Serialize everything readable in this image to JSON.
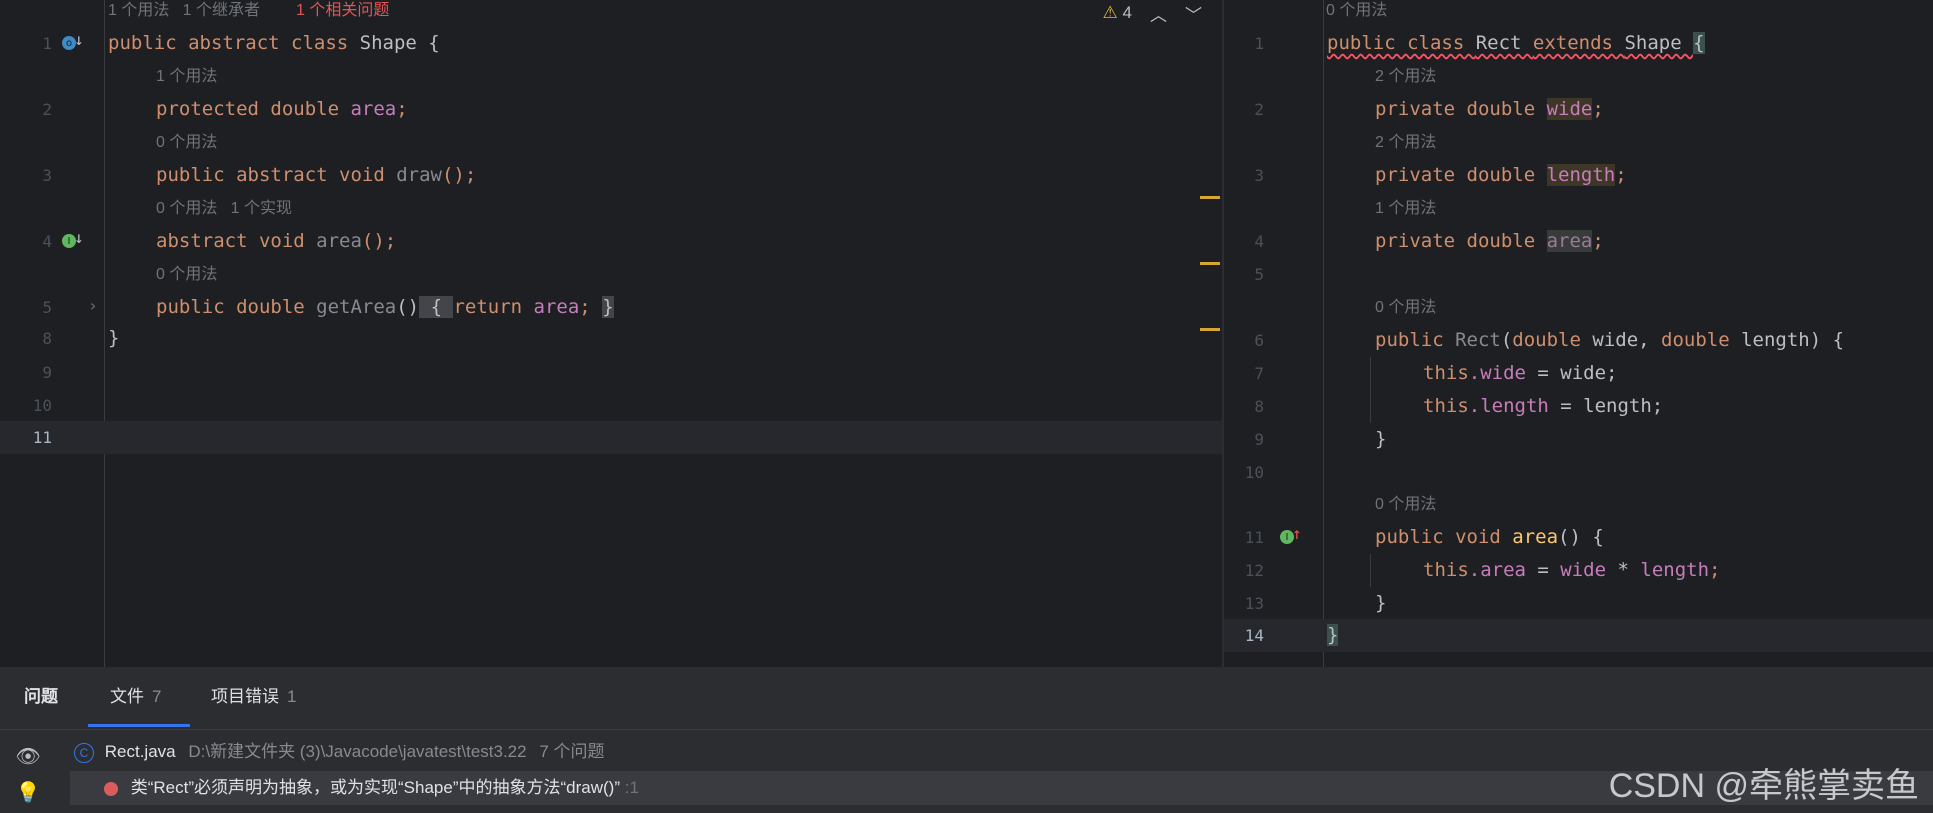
{
  "left": {
    "hint_top": "1 个用法   1 个继承者",
    "hint_problem": "1 个相关问题",
    "warning_count": "4",
    "line_numbers": [
      "1",
      "2",
      "3",
      "4",
      "5",
      "8",
      "9",
      "10",
      "11"
    ],
    "hints": [
      "1 个用法",
      "0 个用法",
      "0 个用法   1 个实现",
      "0 个用法"
    ],
    "code": {
      "l1_kw": "public abstract class ",
      "l1_name": "Shape {",
      "l2_kw": "protected double ",
      "l2_fld": "area",
      "l2_end": ";",
      "l3_kw": "public abstract void ",
      "l3_fn": "draw",
      "l3_end": "();",
      "l4_kw": "abstract void ",
      "l4_fn": "area",
      "l4_end": "();",
      "l5_kw": "public double ",
      "l5_fn": "getArea",
      "l5_paren": "()",
      "l5_open": " { ",
      "l5_ret": "return ",
      "l5_fld": "area",
      "l5_semi": "; ",
      "l5_close": "}",
      "l8": "}"
    }
  },
  "right": {
    "hint_top": "0 个用法",
    "line_numbers": [
      "1",
      "2",
      "3",
      "4",
      "5",
      "6",
      "7",
      "8",
      "9",
      "10",
      "11",
      "12",
      "13",
      "14"
    ],
    "hints": [
      "2 个用法",
      "2 个用法",
      "1 个用法",
      "0 个用法",
      "0 个用法"
    ],
    "code": {
      "l1_kw": "public class ",
      "l1_name": "Rect ",
      "l1_ext": "extends ",
      "l1_sup": "Shape ",
      "l1_brace": "{",
      "l2_kw": "private double ",
      "l2_fld": "wide",
      "l3_kw": "private double ",
      "l3_fld": "length",
      "l4_kw": "private double ",
      "l4_fld": "area",
      "semi": ";",
      "l6_kw": "public ",
      "l6_fn": "Rect",
      "l6_p1": "(",
      "l6_t1": "double ",
      "l6_a1": "wide, ",
      "l6_t2": "double ",
      "l6_a2": "length) {",
      "l7_this": "this",
      "l7_fld": ".wide",
      "l7_rest": " = wide;",
      "l8_this": "this",
      "l8_fld": ".length",
      "l8_rest": " = length;",
      "l9": "}",
      "l11_kw": "public void ",
      "l11_fn": "area",
      "l11_rest": "() {",
      "l12_this": "this",
      "l12_fld": ".area",
      "l12_eq": " = ",
      "l12_a": "wide",
      "l12_op": " * ",
      "l12_b": "length",
      "l12_end": ";",
      "l13": "}",
      "l14": "}"
    }
  },
  "problems": {
    "tab1": "问题",
    "tab2": "文件",
    "tab2_count": "7",
    "tab3": "项目错误",
    "tab3_count": "1",
    "file_name": "Rect.java",
    "file_path": "D:\\新建文件夹 (3)\\Javacode\\javatest\\test3.22",
    "file_count": "7 个问题",
    "error_msg": "类“Rect”必须声明为抽象，或为实现“Shape”中的抽象方法“draw()”",
    "error_line": ":1"
  },
  "watermark": "CSDN @牵熊掌卖鱼",
  "colors": {
    "keyword": "#cf8e6d",
    "field": "#c77dbb",
    "error": "#f75464",
    "accent": "#3574f0"
  }
}
